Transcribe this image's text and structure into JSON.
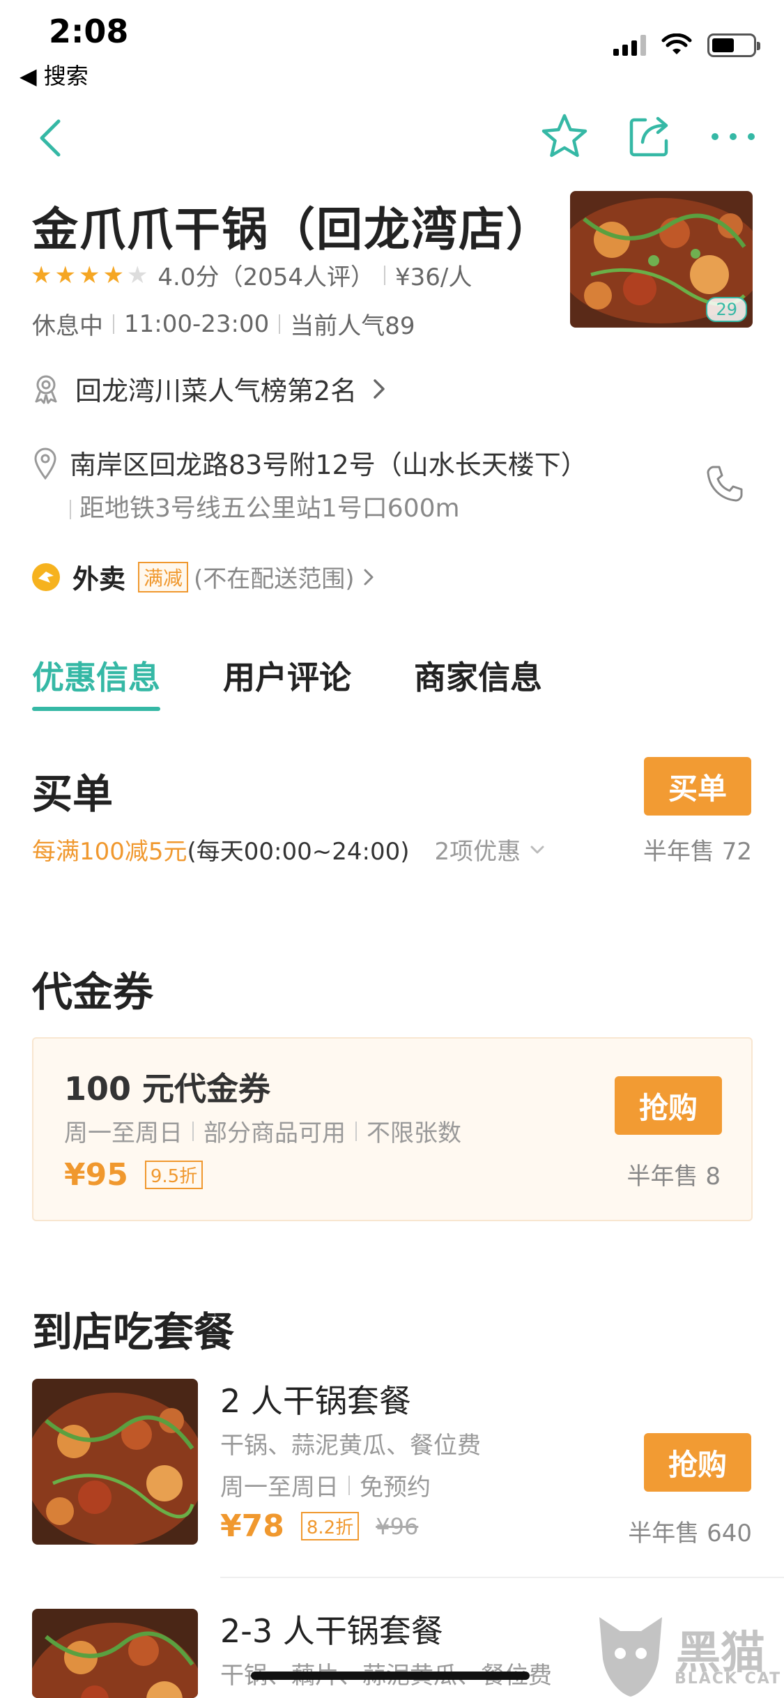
{
  "status_bar": {
    "time": "2:08",
    "back_app": "◀ 搜索"
  },
  "shop": {
    "name": "金爪爪干锅（回龙湾店）",
    "rating": 4,
    "rating_text": "4.0分（2054人评）",
    "price_per_person": "¥36/人",
    "status": "休息中",
    "hours": "11:00-23:00",
    "popularity": "当前人气89",
    "photo_count": "29",
    "rank": "回龙湾川菜人气榜第2名",
    "address": "南岸区回龙路83号附12号（山水长天楼下）",
    "metro": "距地铁3号线五公里站1号口600m"
  },
  "delivery": {
    "label": "外卖",
    "badge": "满减",
    "note": "(不在配送范围)"
  },
  "tabs": [
    {
      "label": "优惠信息",
      "active": true
    },
    {
      "label": "用户评论",
      "active": false
    },
    {
      "label": "商家信息",
      "active": false
    }
  ],
  "pay": {
    "title": "买单",
    "button": "买单",
    "promo_highlight": "每满100减5元",
    "promo_time": "(每天00:00~24:00)",
    "promo_more": "2项优惠",
    "sold": "半年售 72"
  },
  "voucher": {
    "section_title": "代金券",
    "name": "100 元代金券",
    "tags": [
      "周一至周日",
      "部分商品可用",
      "不限张数"
    ],
    "price": "¥95",
    "discount": "9.5折",
    "button": "抢购",
    "sold": "半年售 8"
  },
  "packages": {
    "section_title": "到店吃套餐",
    "items": [
      {
        "title": "2 人干锅套餐",
        "desc": "干锅、蒜泥黄瓜、餐位费",
        "tags": [
          "周一至周日",
          "免预约"
        ],
        "price": "¥78",
        "discount": "8.2折",
        "old_price": "¥96",
        "button": "抢购",
        "sold": "半年售 640"
      },
      {
        "title": "2-3 人干锅套餐",
        "desc": "干锅、藕片、蒜泥黄瓜、餐位费"
      }
    ]
  },
  "watermark": {
    "text": "黑猫",
    "sub": "BLACK CAT"
  },
  "colors": {
    "accent": "#35b8a5",
    "orange": "#f29b33",
    "star": "#f5a623"
  }
}
